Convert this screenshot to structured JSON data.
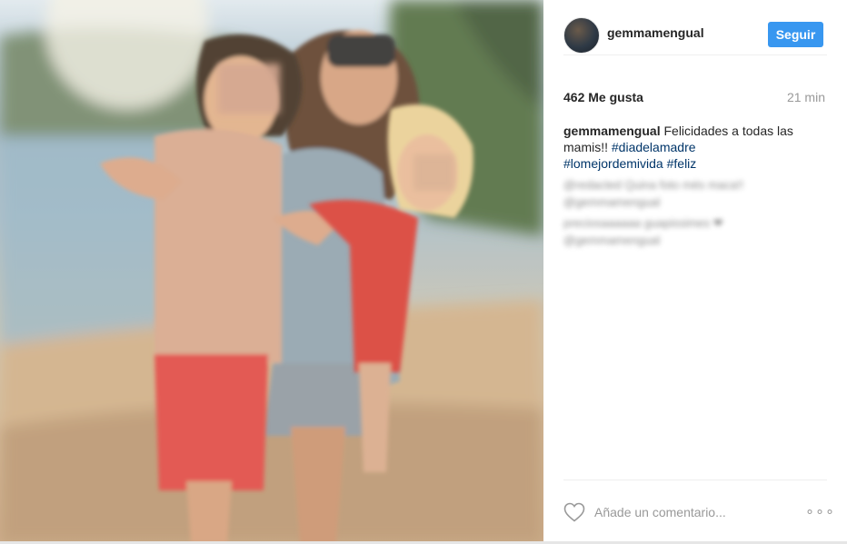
{
  "post": {
    "username": "gemmamengual",
    "follow_label": "Seguir",
    "likes": "462 Me gusta",
    "time_ago": "21 min",
    "caption_user": "gemmamengual",
    "caption_text": " Felicidades a todas las mamis!! ",
    "hashtags": [
      "#diadelamadre",
      "#lomejordemivida",
      "#feliz"
    ],
    "comment_placeholder": "Añade un comentario...",
    "more_label": "∘∘∘"
  },
  "blurred_comments": [
    {
      "text": "@redacted Quina foto més maca!! @gemmamengual"
    },
    {
      "text": "preciosaaaaaa guapissimes ❤ @gemmamengual"
    }
  ],
  "photo": {
    "description_icon": "beach-family-photo"
  },
  "colors": {
    "accent": "#3897f0",
    "hashtag": "#003569",
    "muted": "#999999"
  }
}
